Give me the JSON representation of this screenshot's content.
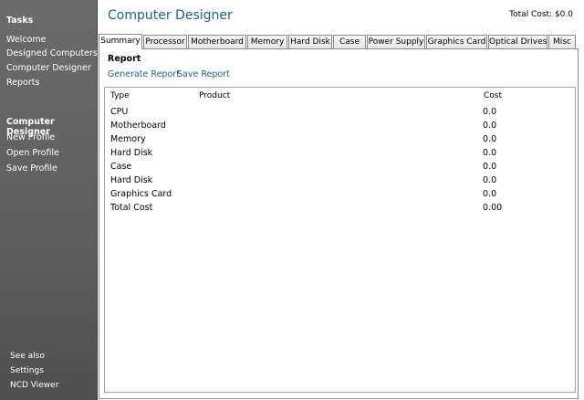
{
  "sidebar": {
    "tasks_heading": "Tasks",
    "tasks": [
      "Welcome",
      "Designed Computers",
      "Computer Designer",
      "Reports"
    ],
    "designer_heading": "Computer Designer",
    "designer_items": [
      "New Profile",
      "Open Profile",
      "Save Profile"
    ],
    "see_also_heading": "See also",
    "see_also_items": [
      "Settings",
      "NCD Viewer"
    ]
  },
  "header": {
    "title": "Computer Designer",
    "total_cost": "Total Cost: $0.0"
  },
  "tabs": [
    "Summary",
    "Processor",
    "Motherboard",
    "Memory",
    "Hard Disk",
    "Case",
    "Power Supply",
    "Graphics Card",
    "Optical Drives",
    "Misc"
  ],
  "report": {
    "heading": "Report",
    "generate_label": "Generate Report",
    "save_label": "Save Report",
    "columns": [
      "Type",
      "Product",
      "Cost"
    ],
    "rows": [
      {
        "type": "CPU",
        "product": "",
        "cost": "0.0"
      },
      {
        "type": "Motherboard",
        "product": "",
        "cost": "0.0"
      },
      {
        "type": "Memory",
        "product": "",
        "cost": "0.0"
      },
      {
        "type": "Hard Disk",
        "product": "",
        "cost": "0.0"
      },
      {
        "type": "Case",
        "product": "",
        "cost": "0.0"
      },
      {
        "type": "Hard Disk",
        "product": "",
        "cost": "0.0"
      },
      {
        "type": "Graphics Card",
        "product": "",
        "cost": "0.0"
      },
      {
        "type": "Total Cost",
        "product": "",
        "cost": "0.00"
      }
    ]
  }
}
